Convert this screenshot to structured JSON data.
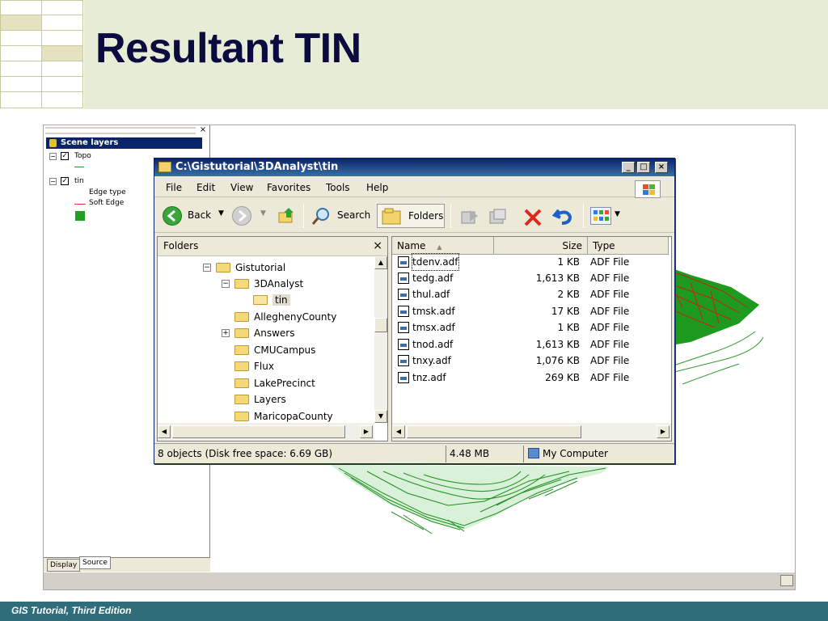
{
  "slide": {
    "title": "Resultant TIN",
    "footer": "GIS Tutorial, Third Edition"
  },
  "toc": {
    "header": "Scene layers",
    "layer1": "Topo",
    "layer2": "tin",
    "edge_type": "Edge type",
    "soft_edge": "Soft Edge",
    "tab_display": "Display",
    "tab_source": "Source",
    "close_glyph": "×",
    "colors": {
      "soft_edge": "#e03020",
      "fill": "#20a020"
    }
  },
  "explorer": {
    "title": "C:\\Gistutorial\\3DAnalyst\\tin",
    "menu": [
      "File",
      "Edit",
      "View",
      "Favorites",
      "Tools",
      "Help"
    ],
    "toolbar": {
      "back": "Back",
      "search": "Search",
      "folders": "Folders"
    },
    "folders_pane": {
      "header": "Folders",
      "close": "×",
      "tree": [
        {
          "label": "Gistutorial",
          "expander": "−"
        },
        {
          "label": "3DAnalyst",
          "expander": "−"
        },
        {
          "label": "tin",
          "expander": ""
        },
        {
          "label": "AlleghenyCounty",
          "expander": ""
        },
        {
          "label": "Answers",
          "expander": "+"
        },
        {
          "label": "CMUCampus",
          "expander": ""
        },
        {
          "label": "Flux",
          "expander": ""
        },
        {
          "label": "LakePrecinct",
          "expander": ""
        },
        {
          "label": "Layers",
          "expander": ""
        },
        {
          "label": "MaricopaCounty",
          "expander": ""
        }
      ]
    },
    "list": {
      "columns": {
        "name": "Name",
        "size": "Size",
        "type": "Type"
      },
      "rows": [
        {
          "name": "tdenv.adf",
          "size": "1 KB",
          "type": "ADF File"
        },
        {
          "name": "tedg.adf",
          "size": "1,613 KB",
          "type": "ADF File"
        },
        {
          "name": "thul.adf",
          "size": "2 KB",
          "type": "ADF File"
        },
        {
          "name": "tmsk.adf",
          "size": "17 KB",
          "type": "ADF File"
        },
        {
          "name": "tmsx.adf",
          "size": "1 KB",
          "type": "ADF File"
        },
        {
          "name": "tnod.adf",
          "size": "1,613 KB",
          "type": "ADF File"
        },
        {
          "name": "tnxy.adf",
          "size": "1,076 KB",
          "type": "ADF File"
        },
        {
          "name": "tnz.adf",
          "size": "269 KB",
          "type": "ADF File"
        }
      ]
    },
    "status": {
      "objects": "8 objects (Disk free space: 6.69 GB)",
      "size": "4.48 MB",
      "location": "My Computer"
    }
  }
}
